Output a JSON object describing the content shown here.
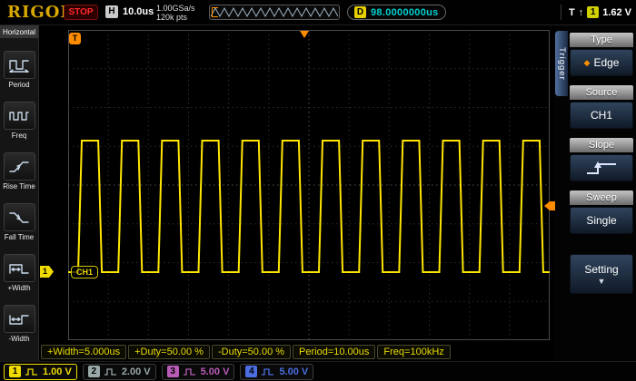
{
  "top_bar": {
    "brand": "RIGOL",
    "run_state": "STOP",
    "h_label": "H",
    "timebase": "10.0us",
    "sample_rate": "1.00GSa/s",
    "mem_depth": "120k pts",
    "delay_label": "D",
    "delay_value": "98.0000000us",
    "trigger_label": "T",
    "trigger_source_num": "1",
    "trigger_level": "1.62 V"
  },
  "icons": {
    "diamond": "◆",
    "down_arrow": "▼",
    "up_arrow": "↑"
  },
  "left_menu": {
    "title": "Horizontal",
    "items": [
      {
        "label": "Period",
        "icon": "period-icon"
      },
      {
        "label": "Freq",
        "icon": "freq-icon"
      },
      {
        "label": "Rise Time",
        "icon": "rise-time-icon"
      },
      {
        "label": "Fall Time",
        "icon": "fall-time-icon"
      },
      {
        "label": "+Width",
        "icon": "pos-width-icon"
      },
      {
        "label": "-Width",
        "icon": "neg-width-icon"
      }
    ]
  },
  "display": {
    "channel_tag": "CH1",
    "trigger_badge": "T",
    "ground_marker_num": "1"
  },
  "right_menu": {
    "tab": "Trigger",
    "sections": [
      {
        "header": "Type",
        "value": "Edge"
      },
      {
        "header": "Source",
        "value": "CH1"
      },
      {
        "header": "Slope",
        "value": ""
      },
      {
        "header": "Sweep",
        "value": "Single"
      }
    ],
    "setting_label": "Setting"
  },
  "measurements": [
    "+Width=5.000us",
    "+Duty=50.00 %",
    "-Duty=50.00 %",
    "Period=10.00us",
    "Freq=100kHz"
  ],
  "channels": [
    {
      "num": "1",
      "scale": "1.00 V",
      "color": "#f0dc00",
      "active": true
    },
    {
      "num": "2",
      "scale": "2.00 V",
      "color": "#9aa8a8",
      "active": false
    },
    {
      "num": "3",
      "scale": "5.00 V",
      "color": "#b85cb8",
      "active": false
    },
    {
      "num": "4",
      "scale": "5.00 V",
      "color": "#4a6ee0",
      "active": false
    }
  ],
  "waveform": {
    "type": "square",
    "cycles_visible": 12,
    "duty_percent": 50,
    "period_us": 10.0,
    "freq": "100kHz",
    "trace_color": "#ffe600"
  },
  "grid": {
    "h_divs": 12,
    "v_divs": 8
  }
}
